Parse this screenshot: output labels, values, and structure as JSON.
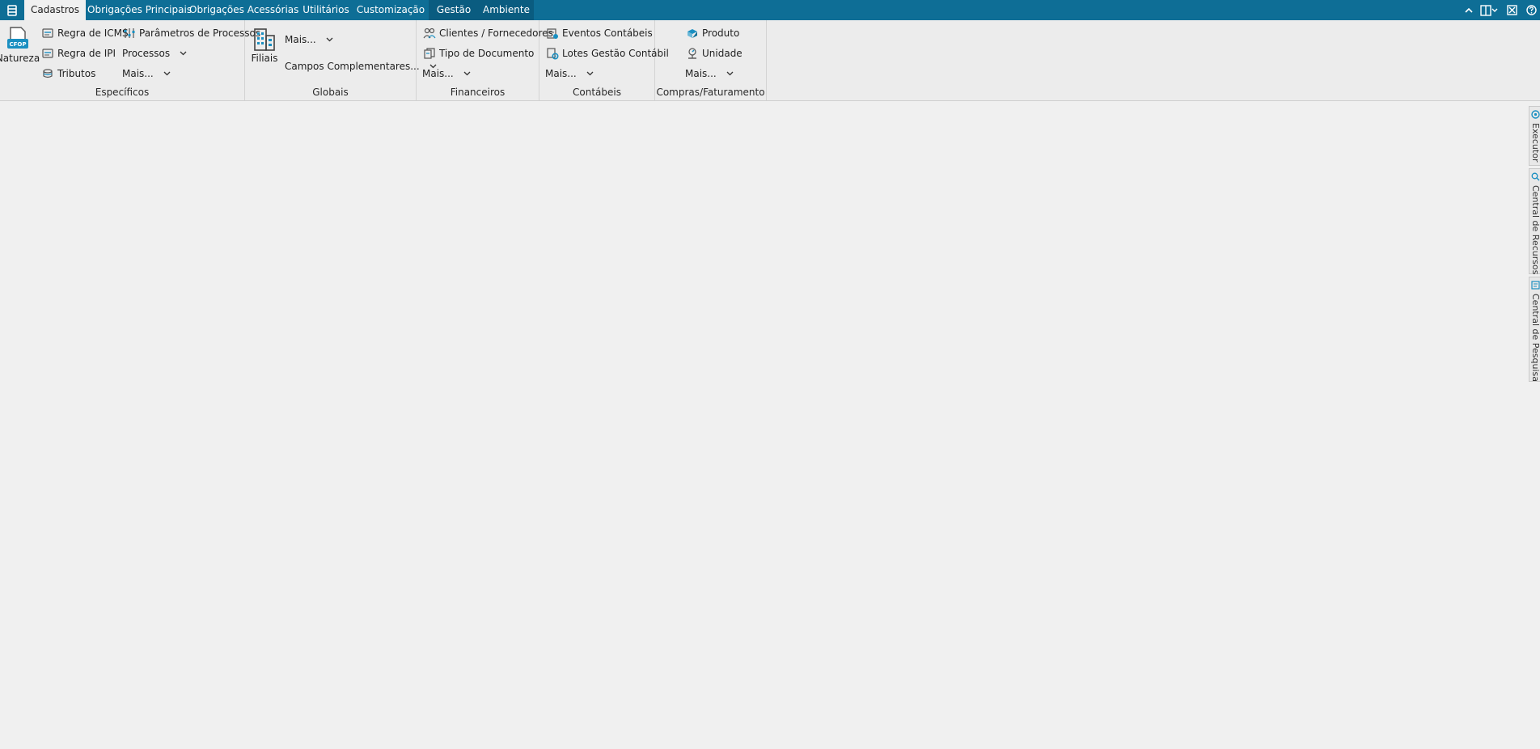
{
  "tabs": [
    {
      "label": "Cadastros"
    },
    {
      "label": "Obrigações Principais"
    },
    {
      "label": "Obrigações Acessórias"
    },
    {
      "label": "Utilitários"
    },
    {
      "label": "Customização"
    },
    {
      "label": "Gestão"
    },
    {
      "label": "Ambiente"
    }
  ],
  "icons": {
    "app_menu": "app-menu-icon",
    "collapse": "chevron-up-icon",
    "layout": "layout-icon",
    "close": "close-box-icon",
    "help": "help-icon"
  },
  "colors": {
    "tabbar": "#0e6e96",
    "accent": "#1a8fc1",
    "panel": "#f0f0f0"
  },
  "groups": {
    "especificos": {
      "label": "Específicos",
      "natureza": "Natureza",
      "natureza_badge": "CFOP",
      "regra_icms": "Regra de ICMS",
      "regra_ipi": "Regra de IPI",
      "tributos": "Tributos",
      "parametros": "Parâmetros de Processos",
      "processos": "Processos",
      "mais": "Mais..."
    },
    "globais": {
      "label": "Globais",
      "filiais": "Filiais",
      "mais": "Mais...",
      "campos": "Campos Complementares..."
    },
    "financeiros": {
      "label": "Financeiros",
      "clientes": "Clientes / Fornecedores",
      "tipo_doc": "Tipo de Documento",
      "mais": "Mais..."
    },
    "contabeis": {
      "label": "Contábeis",
      "eventos": "Eventos Contábeis",
      "lotes": "Lotes Gestão Contábil",
      "mais": "Mais..."
    },
    "compras": {
      "label": "Compras/Faturamento",
      "produto": "Produto",
      "unidade": "Unidade",
      "mais": "Mais..."
    }
  },
  "side_panels": [
    {
      "label": "Executor"
    },
    {
      "label": "Central de Recursos"
    },
    {
      "label": "Central de Pesquisa"
    }
  ]
}
